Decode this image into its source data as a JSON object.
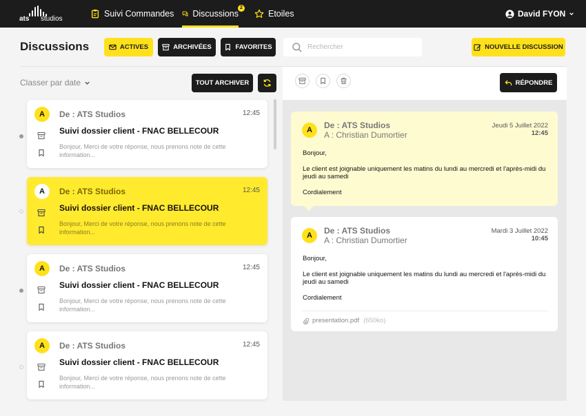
{
  "brand": {
    "bold": "ats",
    "light": "studios"
  },
  "nav": {
    "items": [
      {
        "label": "Suivi Commandes",
        "icon": "clipboard-icon"
      },
      {
        "label": "Discussions",
        "icon": "chat-icon",
        "badge": "2",
        "active": true
      },
      {
        "label": "Etoiles",
        "icon": "star-icon"
      }
    ]
  },
  "user": {
    "name": "David FYON"
  },
  "page": {
    "title": "Discussions"
  },
  "filters": {
    "active": "ACTIVES",
    "archived": "ARCHIVÉES",
    "favorites": "FAVORITES"
  },
  "search": {
    "placeholder": "Rechercher"
  },
  "new_discussion": "NOUVELLE DISCUSSION",
  "list": {
    "sort_label": "Classer par date",
    "archive_all": "TOUT ARCHIVER",
    "items": [
      {
        "avatar": "A",
        "from": "De : ATS Studios",
        "time": "12:45",
        "subject": "Suivi dossier client - FNAC BELLECOUR",
        "preview": "Bonjour, Merci de votre réponse, nous prenons note de cette information...",
        "unread": true,
        "selected": false
      },
      {
        "avatar": "A",
        "from": "De : ATS Studios",
        "time": "12:45",
        "subject": "Suivi dossier client - FNAC BELLECOUR",
        "preview": "Bonjour, Merci de votre réponse, nous prenons note de cette information...",
        "unread": false,
        "selected": true
      },
      {
        "avatar": "A",
        "from": "De : ATS Studios",
        "time": "12:45",
        "subject": "Suivi dossier client - FNAC BELLECOUR",
        "preview": "Bonjour, Merci de votre réponse, nous prenons note de cette information...",
        "unread": true,
        "selected": false
      },
      {
        "avatar": "A",
        "from": "De : ATS Studios",
        "time": "12:45",
        "subject": "Suivi dossier client - FNAC BELLECOUR",
        "preview": "Bonjour, Merci de votre réponse, nous prenons note de cette information...",
        "unread": false,
        "selected": false
      }
    ]
  },
  "reply": "RÉPONDRE",
  "messages": [
    {
      "avatar": "A",
      "from": "De : ATS Studios",
      "to": "A : Christian Dumortier",
      "date": "Jeudi 5 Juillet 2022",
      "hour": "12:45",
      "lines": [
        "Bonjour,",
        "Le client est joignable uniquement les matins du lundi au mercredi et l'après-midi du jeudi au samedi",
        "Cordialement"
      ]
    },
    {
      "avatar": "A",
      "from": "De : ATS Studios",
      "to": "A : Christian Dumortier",
      "date": "Mardi 3 Juillet 2022",
      "hour": "10:45",
      "lines": [
        "Bonjour,",
        "Le client est joignable uniquement les matins du lundi au mercredi et l'après-midi du jeudi au samedi",
        "Cordialement"
      ],
      "attachment": {
        "name": "presentation.pdf",
        "size": "(650ko)"
      }
    }
  ],
  "colors": {
    "accent": "#ffe11b",
    "dark": "#1c1c1c",
    "selected_card": "#ffea2e",
    "highlight_message": "#fffbd1"
  }
}
